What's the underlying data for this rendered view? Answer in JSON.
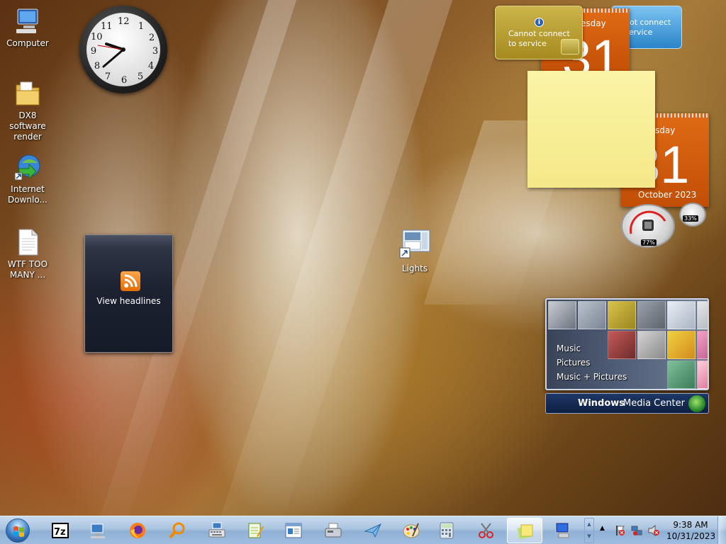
{
  "desktop": {
    "icons": [
      {
        "label": "Computer",
        "icon": "computer-icon"
      },
      {
        "label": "DX8 software render",
        "icon": "folder-icon"
      },
      {
        "label": "Internet Downlo...",
        "icon": "internet-download-manager-icon"
      },
      {
        "label": "WTF TOO MANY ...",
        "icon": "text-document-icon"
      },
      {
        "label": "Lights",
        "icon": "lights-shortcut-icon"
      }
    ]
  },
  "gadgets": {
    "clock": {
      "numbers": [
        "12",
        "1",
        "2",
        "3",
        "4",
        "5",
        "6",
        "7",
        "8",
        "9",
        "10",
        "11"
      ],
      "time": "9:38"
    },
    "rss": {
      "label": "View headlines"
    },
    "weather_back": {
      "message": "not connect\nservice"
    },
    "weather_front": {
      "message": "Cannot connect\nto service"
    },
    "calendar_back": {
      "day": "esday",
      "date": "31"
    },
    "calendar_front": {
      "day": "uesday",
      "date": "31",
      "month": "October 2023"
    },
    "cpu_meter": {
      "cpu": "77%",
      "memory": "33%"
    },
    "media_center": {
      "menu": [
        "Music",
        "Pictures",
        "Music + Pictures"
      ],
      "brand_bold": "Windows",
      "brand_rest": "Media Center"
    }
  },
  "taskbar": {
    "apps": [
      {
        "name": "7-zip",
        "icon": "7zip-icon"
      },
      {
        "name": "Network",
        "icon": "network-computer-icon"
      },
      {
        "name": "Firefox",
        "icon": "firefox-icon"
      },
      {
        "name": "Search",
        "icon": "magnifier-icon"
      },
      {
        "name": "Keyboard",
        "icon": "keyboard-icon"
      },
      {
        "name": "Notepad++",
        "icon": "notepad-plus-icon"
      },
      {
        "name": "WordPad",
        "icon": "wordpad-icon"
      },
      {
        "name": "Fax",
        "icon": "fax-icon"
      },
      {
        "name": "Paper plane",
        "icon": "paper-plane-icon"
      },
      {
        "name": "Paint",
        "icon": "paint-palette-icon"
      },
      {
        "name": "Calculator",
        "icon": "calculator-icon"
      },
      {
        "name": "Snipping Tool",
        "icon": "scissors-icon"
      },
      {
        "name": "Sticky Notes",
        "icon": "sticky-notes-icon"
      },
      {
        "name": "Remote Desktop",
        "icon": "remote-desktop-icon"
      }
    ],
    "clock_time": "9:38 AM",
    "clock_date": "10/31/2023"
  },
  "colors": {
    "calendar_orange": "#d8600e",
    "note_yellow": "#f8ee98",
    "taskbar_blue": "#a9c3df"
  }
}
